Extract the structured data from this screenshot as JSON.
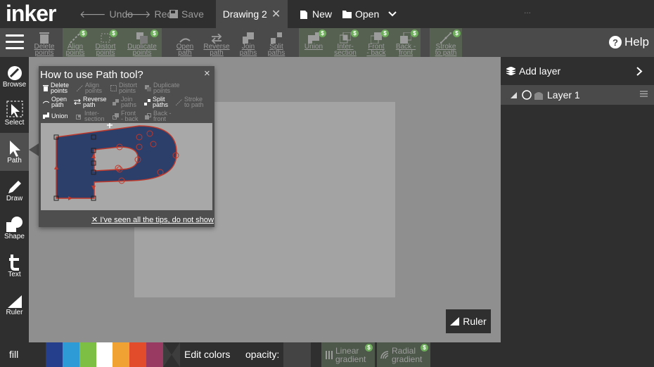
{
  "app": {
    "logo": "inker"
  },
  "top": {
    "undo": "Undo",
    "redo": "Redo",
    "save": "Save",
    "tab": "Drawing 2",
    "new": "New",
    "open": "Open",
    "more": "..."
  },
  "toolbar": {
    "delete_points": [
      "Delete",
      "points"
    ],
    "align_points": [
      "Align",
      "points"
    ],
    "distort_points": [
      "Distort",
      "points"
    ],
    "duplicate_points": [
      "Duplicate",
      "points"
    ],
    "open_path": [
      "Open",
      "path"
    ],
    "reverse_path": [
      "Reverse",
      "path"
    ],
    "join_paths": [
      "Join",
      "paths"
    ],
    "split_paths": [
      "Split",
      "paths"
    ],
    "union": [
      "Union"
    ],
    "intersection": [
      "Inter-",
      "section"
    ],
    "front_back": [
      "Front",
      "- back"
    ],
    "back_front": [
      "Back -",
      "front"
    ],
    "stroke_to_path": [
      "Stroke",
      "to path"
    ],
    "help": "Help",
    "premium_badge": "$"
  },
  "sidebar": [
    "Browse",
    "Select",
    "Path",
    "Draw",
    "Shape",
    "Text",
    "Ruler"
  ],
  "popup": {
    "title": "How to use Path tool?",
    "close": "×",
    "footer": "I've seen all the tips, do not show",
    "items": {
      "delete": [
        "Delete",
        "points"
      ],
      "align": [
        "Align",
        "points"
      ],
      "distort": [
        "Distort",
        "points"
      ],
      "duplicate": [
        "Duplicate",
        "points"
      ],
      "open": [
        "Open",
        "path"
      ],
      "reverse": [
        "Reverse",
        "path"
      ],
      "join": [
        "Join",
        "paths"
      ],
      "split": [
        "Split",
        "paths"
      ],
      "stroke": [
        "Stroke",
        "to path"
      ],
      "union": [
        "Union"
      ],
      "inter": [
        "Inter-",
        "section"
      ],
      "front": [
        "Front",
        "- back"
      ],
      "back": [
        "Back -",
        "front"
      ]
    }
  },
  "layers": {
    "add": "Add layer",
    "layer1": "Layer 1"
  },
  "ruler": "Ruler",
  "bottom": {
    "fill": "fill",
    "swatches": [
      "#253f8c",
      "#2e9ad6",
      "#7dbf45",
      "#ffffff",
      "#f0a233",
      "#e24c2a",
      "#983a62"
    ],
    "edit_colors": "Edit colors",
    "opacity": "opacity:",
    "linear": [
      "Linear",
      "gradient"
    ],
    "radial": [
      "Radial",
      "gradient"
    ]
  },
  "colors": {
    "path_fill": "#2c3e6a",
    "path_stroke": "#c0392b",
    "premium_green": "#6fae5c"
  }
}
